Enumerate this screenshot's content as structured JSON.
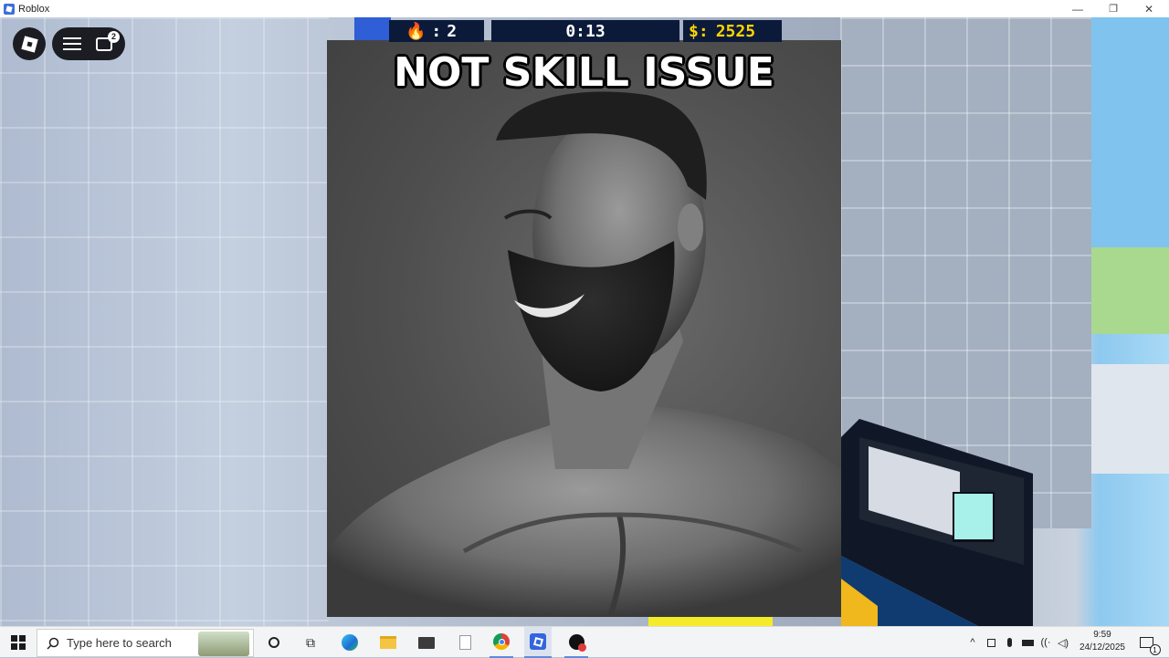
{
  "window": {
    "title": "Roblox",
    "controls": {
      "minimize": "—",
      "restore": "❐",
      "close": "✕"
    }
  },
  "roblox_overlay": {
    "chat_badge": "2"
  },
  "hud": {
    "kills": "2",
    "timer": "0:13",
    "money_label": "$:",
    "money": "2525"
  },
  "meme": {
    "caption": "NOT SKILL ISSUE"
  },
  "taskbar": {
    "search_placeholder": "Type here to search",
    "time": "9:59",
    "date": "24/12/2025",
    "notification_count": "1"
  },
  "colors": {
    "hud_bg": "#0c1a3a",
    "money_yellow": "#ffd400",
    "roblox_dark": "#1b1d22"
  }
}
